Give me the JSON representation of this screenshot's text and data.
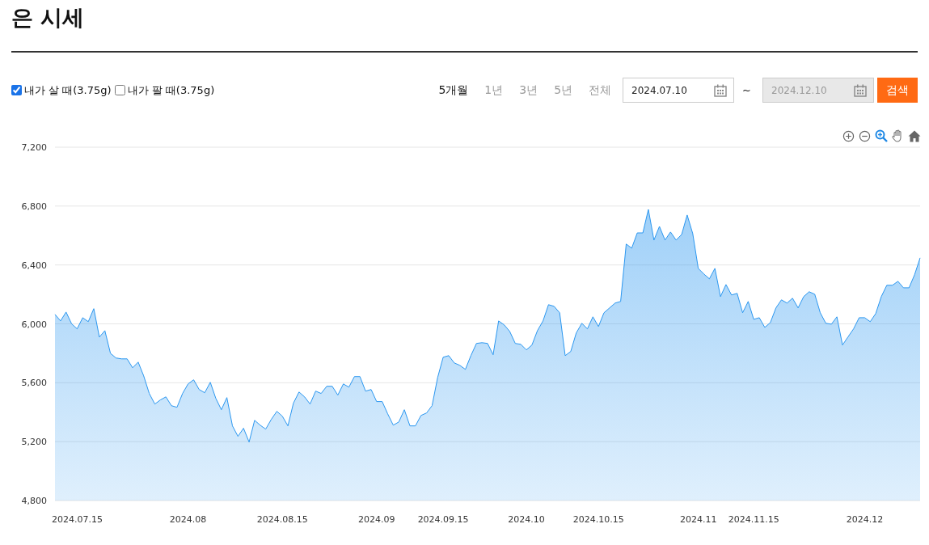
{
  "title": "은 시세",
  "options": [
    {
      "label": "내가 살 때(3.75g)",
      "checked": true
    },
    {
      "label": "내가 팔 때(3.75g)",
      "checked": false
    }
  ],
  "periods": [
    {
      "label": "5개월",
      "selected": true
    },
    {
      "label": "1년",
      "selected": false
    },
    {
      "label": "3년",
      "selected": false
    },
    {
      "label": "5년",
      "selected": false
    },
    {
      "label": "전체",
      "selected": false
    }
  ],
  "date_from": {
    "value": "2024.07.10",
    "disabled": false
  },
  "separator": "~",
  "date_to": {
    "value": "2024.12.10",
    "disabled": true
  },
  "search_button": "검색",
  "chart": {
    "chart_data": {
      "type": "area",
      "categories": [
        null,
        null,
        null,
        null,
        "2024.07.15",
        null,
        null,
        null,
        null,
        null,
        null,
        null,
        null,
        null,
        null,
        null,
        null,
        null,
        null,
        null,
        null,
        null,
        null,
        null,
        "2024.08",
        null,
        null,
        null,
        null,
        null,
        null,
        null,
        null,
        null,
        null,
        null,
        null,
        null,
        null,
        null,
        null,
        "2024.08.15",
        null,
        null,
        null,
        null,
        null,
        null,
        null,
        null,
        null,
        null,
        null,
        null,
        null,
        null,
        null,
        null,
        "2024.09",
        null,
        null,
        null,
        null,
        null,
        null,
        null,
        null,
        null,
        null,
        null,
        "2024.09.15",
        null,
        null,
        null,
        null,
        null,
        null,
        null,
        null,
        null,
        null,
        null,
        null,
        null,
        null,
        "2024.10",
        null,
        null,
        null,
        null,
        null,
        null,
        null,
        null,
        null,
        null,
        null,
        null,
        "2024.10.15",
        null,
        null,
        null,
        null,
        null,
        null,
        null,
        null,
        null,
        null,
        null,
        null,
        null,
        null,
        null,
        null,
        null,
        "2024.11",
        null,
        null,
        null,
        null,
        null,
        null,
        null,
        null,
        null,
        "2024.11.15",
        null,
        null,
        null,
        null,
        null,
        null,
        null,
        null,
        null,
        null,
        null,
        null,
        null,
        null,
        null,
        null,
        null,
        null,
        null,
        "2024.12",
        null,
        null,
        null,
        null,
        null,
        null,
        null,
        null,
        null,
        null
      ],
      "series": [
        {
          "color": "#2b97f0",
          "values": [
            6064,
            6020,
            6080,
            6000,
            5966,
            6042,
            6015,
            6103,
            5910,
            5954,
            5800,
            5768,
            5762,
            5762,
            5702,
            5740,
            5647,
            5527,
            5455,
            5483,
            5504,
            5444,
            5433,
            5527,
            5592,
            5620,
            5554,
            5532,
            5603,
            5494,
            5417,
            5499,
            5307,
            5236,
            5291,
            5197,
            5345,
            5312,
            5285,
            5351,
            5406,
            5373,
            5307,
            5461,
            5537,
            5504,
            5455,
            5543,
            5527,
            5576,
            5576,
            5516,
            5592,
            5570,
            5642,
            5642,
            5543,
            5554,
            5472,
            5472,
            5389,
            5312,
            5334,
            5417,
            5307,
            5307,
            5378,
            5395,
            5444,
            5636,
            5773,
            5784,
            5735,
            5718,
            5691,
            5784,
            5867,
            5872,
            5867,
            5790,
            6020,
            5993,
            5949,
            5867,
            5861,
            5823,
            5856,
            5954,
            6020,
            6130,
            6119,
            6075,
            5784,
            5812,
            5938,
            6004,
            5966,
            6048,
            5982,
            6075,
            6108,
            6141,
            6152,
            6542,
            6514,
            6618,
            6618,
            6777,
            6569,
            6662,
            6569,
            6624,
            6569,
            6607,
            6739,
            6613,
            6377,
            6339,
            6306,
            6377,
            6185,
            6267,
            6196,
            6207,
            6075,
            6152,
            6031,
            6042,
            5976,
            6009,
            6108,
            6163,
            6141,
            6174,
            6108,
            6185,
            6218,
            6201,
            6075,
            6004,
            5998,
            6048,
            5856,
            5911,
            5966,
            6042,
            6042,
            6015,
            6070,
            6185,
            6262,
            6262,
            6289,
            6245,
            6245,
            6333,
            6448
          ]
        }
      ],
      "ylim": [
        4800,
        7200
      ],
      "grid": true,
      "yticks": [
        {
          "value": 4800,
          "label": "4,800"
        },
        {
          "value": 5200,
          "label": "5,200"
        },
        {
          "value": 5600,
          "label": "5,600"
        },
        {
          "value": 6000,
          "label": "6,000"
        },
        {
          "value": 6400,
          "label": "6,400"
        },
        {
          "value": 6800,
          "label": "6,800"
        },
        {
          "value": 7200,
          "label": "7,200"
        }
      ]
    }
  }
}
